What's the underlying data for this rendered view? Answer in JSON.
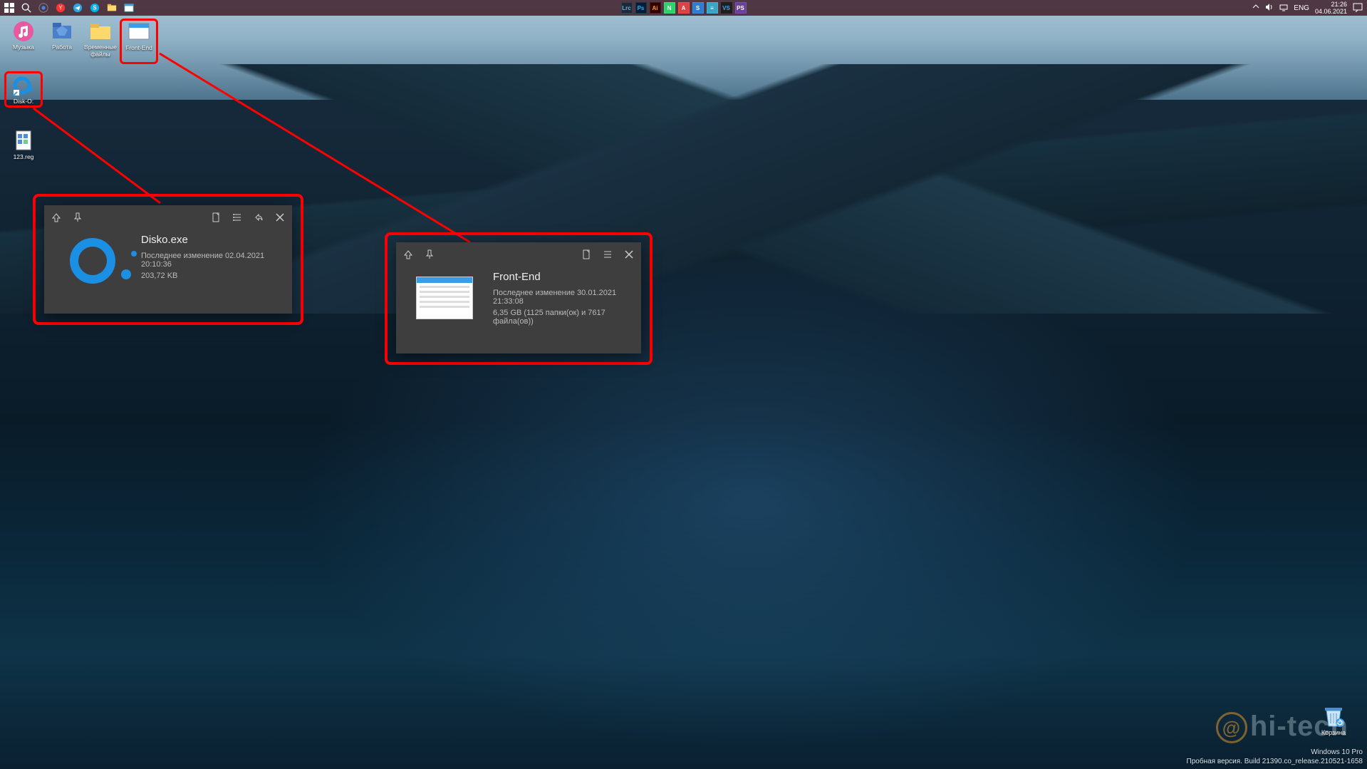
{
  "taskbar": {
    "lang": "ENG",
    "time": "21:26",
    "date": "04.06.2021",
    "center_apps": [
      "Lrc",
      "Ps",
      "Ai",
      "N",
      "A",
      "S",
      "≡",
      "VS",
      "PS"
    ]
  },
  "desktop_icons": {
    "row1": [
      {
        "name": "Музыка"
      },
      {
        "name": "Работа"
      },
      {
        "name": "Временные файлы"
      },
      {
        "name": "Front-End"
      }
    ],
    "disko": "Disk-O:",
    "reg": "123.reg"
  },
  "popup1": {
    "title": "Disko.exe",
    "modified": "Последнее изменение 02.04.2021 20:10:36",
    "size": "203,72 KB"
  },
  "popup2": {
    "title": "Front-End",
    "modified": "Последнее изменение 30.01.2021 21:33:08",
    "size": "6,35 GB  (1125 папки(ок) и 7617 файла(ов))"
  },
  "recycle": "Корзина",
  "watermark": {
    "line1": "Windows 10 Pro",
    "line2": "Пробная версия. Build 21390.co_release.210521-1658"
  },
  "hitech": "hi-tech"
}
